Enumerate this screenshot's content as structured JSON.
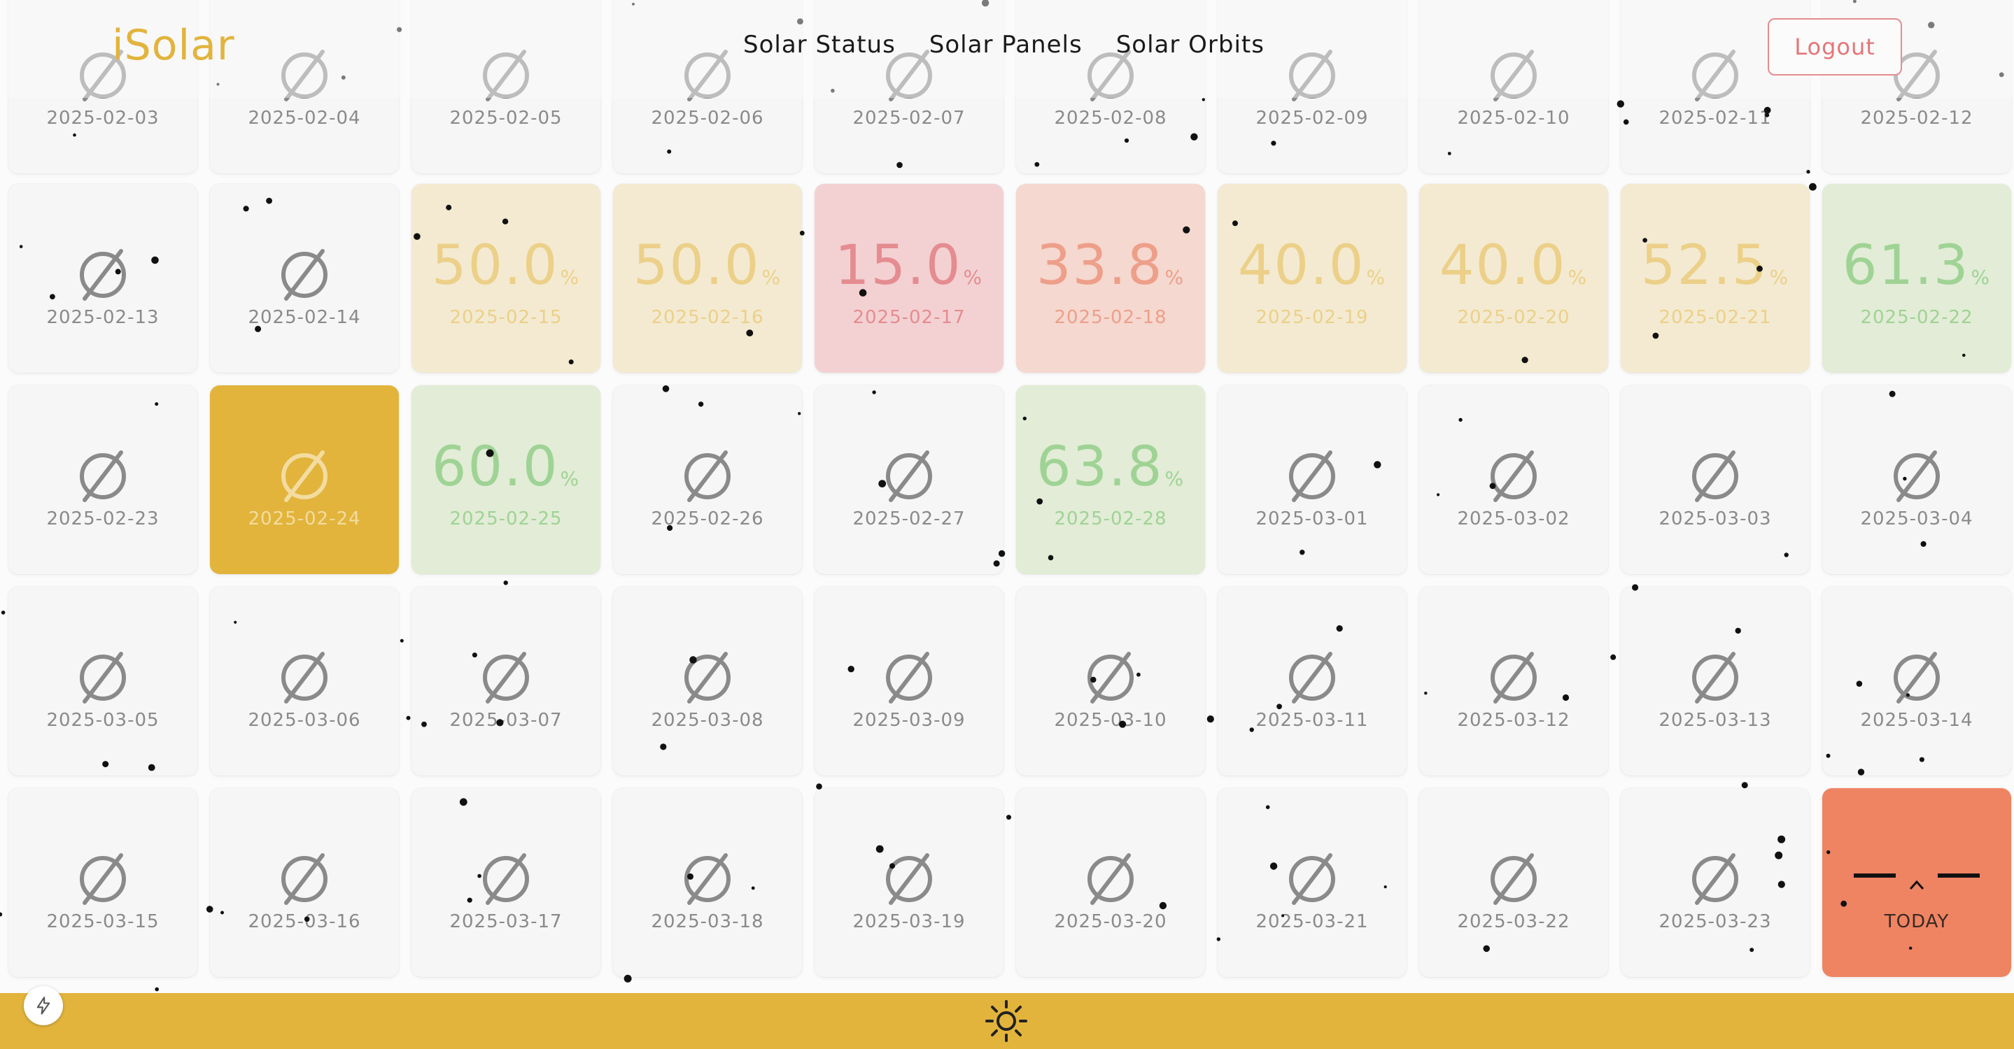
{
  "header": {
    "logo": "iSolar",
    "nav": [
      "Solar Status",
      "Solar Panels",
      "Solar Orbits"
    ],
    "logout_label": "Logout"
  },
  "calendar": {
    "empty_symbol": "∅",
    "percent_symbol": "%",
    "today_label": "TODAY",
    "rows": [
      [
        {
          "date": "2025-02-03",
          "pct": null,
          "status": "empty"
        },
        {
          "date": "2025-02-04",
          "pct": null,
          "status": "empty"
        },
        {
          "date": "2025-02-05",
          "pct": null,
          "status": "empty"
        },
        {
          "date": "2025-02-06",
          "pct": null,
          "status": "empty"
        },
        {
          "date": "2025-02-07",
          "pct": null,
          "status": "empty"
        },
        {
          "date": "2025-02-08",
          "pct": null,
          "status": "empty"
        },
        {
          "date": "2025-02-09",
          "pct": null,
          "status": "empty"
        },
        {
          "date": "2025-02-10",
          "pct": null,
          "status": "empty"
        },
        {
          "date": "2025-02-11",
          "pct": null,
          "status": "empty"
        },
        {
          "date": "2025-02-12",
          "pct": null,
          "status": "empty"
        }
      ],
      [
        {
          "date": "2025-02-13",
          "pct": null,
          "status": "empty"
        },
        {
          "date": "2025-02-14",
          "pct": null,
          "status": "empty"
        },
        {
          "date": "2025-02-15",
          "pct": "50.0",
          "status": "yellow"
        },
        {
          "date": "2025-02-16",
          "pct": "50.0",
          "status": "yellow"
        },
        {
          "date": "2025-02-17",
          "pct": "15.0",
          "status": "red"
        },
        {
          "date": "2025-02-18",
          "pct": "33.8",
          "status": "orange"
        },
        {
          "date": "2025-02-19",
          "pct": "40.0",
          "status": "yellow"
        },
        {
          "date": "2025-02-20",
          "pct": "40.0",
          "status": "yellow"
        },
        {
          "date": "2025-02-21",
          "pct": "52.5",
          "status": "yellow"
        },
        {
          "date": "2025-02-22",
          "pct": "61.3",
          "status": "green"
        }
      ],
      [
        {
          "date": "2025-02-23",
          "pct": null,
          "status": "empty"
        },
        {
          "date": "2025-02-24",
          "pct": null,
          "status": "selected"
        },
        {
          "date": "2025-02-25",
          "pct": "60.0",
          "status": "green"
        },
        {
          "date": "2025-02-26",
          "pct": null,
          "status": "empty"
        },
        {
          "date": "2025-02-27",
          "pct": null,
          "status": "empty"
        },
        {
          "date": "2025-02-28",
          "pct": "63.8",
          "status": "green"
        },
        {
          "date": "2025-03-01",
          "pct": null,
          "status": "empty"
        },
        {
          "date": "2025-03-02",
          "pct": null,
          "status": "empty"
        },
        {
          "date": "2025-03-03",
          "pct": null,
          "status": "empty"
        },
        {
          "date": "2025-03-04",
          "pct": null,
          "status": "empty"
        }
      ],
      [
        {
          "date": "2025-03-05",
          "pct": null,
          "status": "empty"
        },
        {
          "date": "2025-03-06",
          "pct": null,
          "status": "empty"
        },
        {
          "date": "2025-03-07",
          "pct": null,
          "status": "empty"
        },
        {
          "date": "2025-03-08",
          "pct": null,
          "status": "empty"
        },
        {
          "date": "2025-03-09",
          "pct": null,
          "status": "empty"
        },
        {
          "date": "2025-03-10",
          "pct": null,
          "status": "empty"
        },
        {
          "date": "2025-03-11",
          "pct": null,
          "status": "empty"
        },
        {
          "date": "2025-03-12",
          "pct": null,
          "status": "empty"
        },
        {
          "date": "2025-03-13",
          "pct": null,
          "status": "empty"
        },
        {
          "date": "2025-03-14",
          "pct": null,
          "status": "empty"
        }
      ],
      [
        {
          "date": "2025-03-15",
          "pct": null,
          "status": "empty"
        },
        {
          "date": "2025-03-16",
          "pct": null,
          "status": "empty"
        },
        {
          "date": "2025-03-17",
          "pct": null,
          "status": "empty"
        },
        {
          "date": "2025-03-18",
          "pct": null,
          "status": "empty"
        },
        {
          "date": "2025-03-19",
          "pct": null,
          "status": "empty"
        },
        {
          "date": "2025-03-20",
          "pct": null,
          "status": "empty"
        },
        {
          "date": "2025-03-21",
          "pct": null,
          "status": "empty"
        },
        {
          "date": "2025-03-22",
          "pct": null,
          "status": "empty"
        },
        {
          "date": "2025-03-23",
          "pct": null,
          "status": "empty"
        },
        {
          "date": "",
          "pct": null,
          "status": "today"
        }
      ]
    ]
  },
  "footer": {
    "icon": "sun-icon",
    "corner_icon": "lightning-icon"
  },
  "colors": {
    "accent": "#e2b43c",
    "yellow": "#f3ead1",
    "red": "#f3d1d3",
    "orange": "#f5d8cf",
    "green": "#e2ecd6",
    "today": "#ef8462",
    "logout": "#e57579"
  }
}
